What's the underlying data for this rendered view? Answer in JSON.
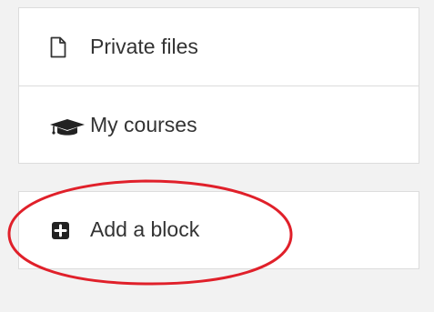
{
  "navigation": {
    "items": [
      {
        "label": "Private files",
        "icon": "file-icon"
      },
      {
        "label": "My courses",
        "icon": "graduation-cap-icon"
      }
    ]
  },
  "add_block": {
    "label": "Add a block",
    "icon": "plus-square-icon"
  },
  "annotation": {
    "shape": "ellipse",
    "color": "#e0202a"
  },
  "colors": {
    "background": "#f2f2f2",
    "card": "#ffffff",
    "border": "#dcdcdc",
    "text": "#333333",
    "icon": "#333333"
  }
}
